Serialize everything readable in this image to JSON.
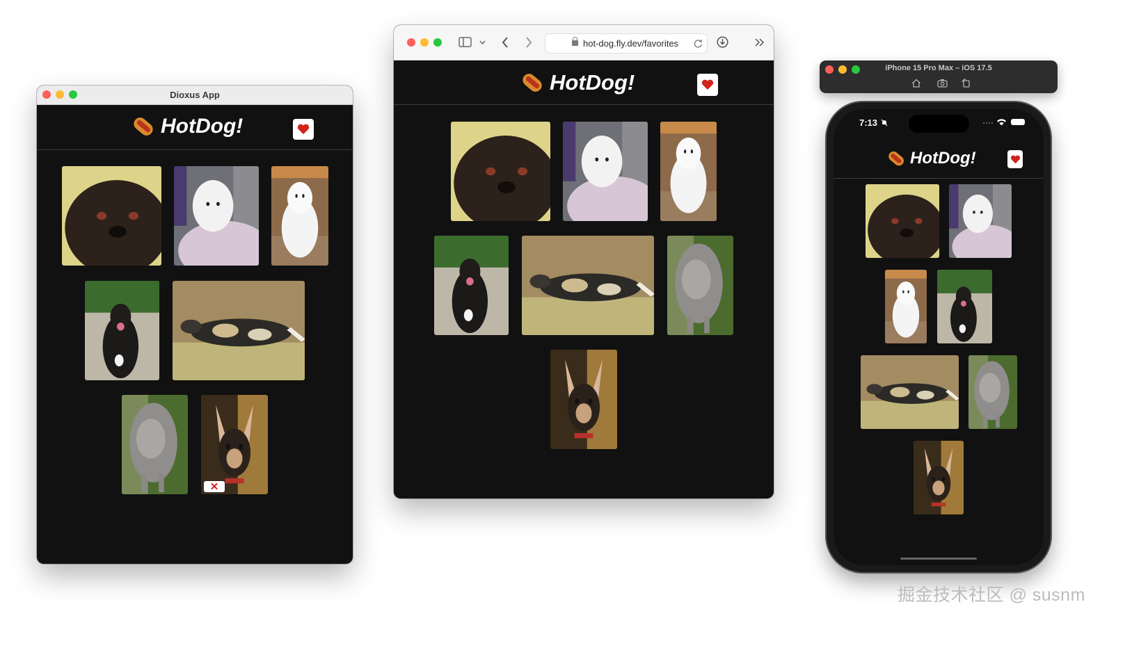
{
  "desktop_window": {
    "title": "Dioxus App",
    "app_title": "HotDog!",
    "fav_icon": "heart-icon",
    "remove_icon": "x-icon"
  },
  "browser_window": {
    "url": "hot-dog.fly.dev/favorites",
    "app_title": "HotDog!",
    "fav_icon": "heart-icon"
  },
  "simulator": {
    "title": "iPhone 15 Pro Max – iOS 17.5",
    "status_time": "7:13",
    "app_title": "HotDog!",
    "fav_icon": "heart-icon"
  },
  "favorites": [
    {
      "subject": "black pug close-up"
    },
    {
      "subject": "white fluffy dog on chair"
    },
    {
      "subject": "white spitz sitting"
    },
    {
      "subject": "black dog in garden"
    },
    {
      "subject": "african wild dog walking"
    },
    {
      "subject": "grey curly poodle"
    },
    {
      "subject": "chihuahua with big ears"
    }
  ],
  "colors": {
    "app_background": "#111111",
    "heart": "#d0241d",
    "hotdog_bun": "#d98a2b"
  },
  "watermark": "掘金技术社区 @ susnm"
}
